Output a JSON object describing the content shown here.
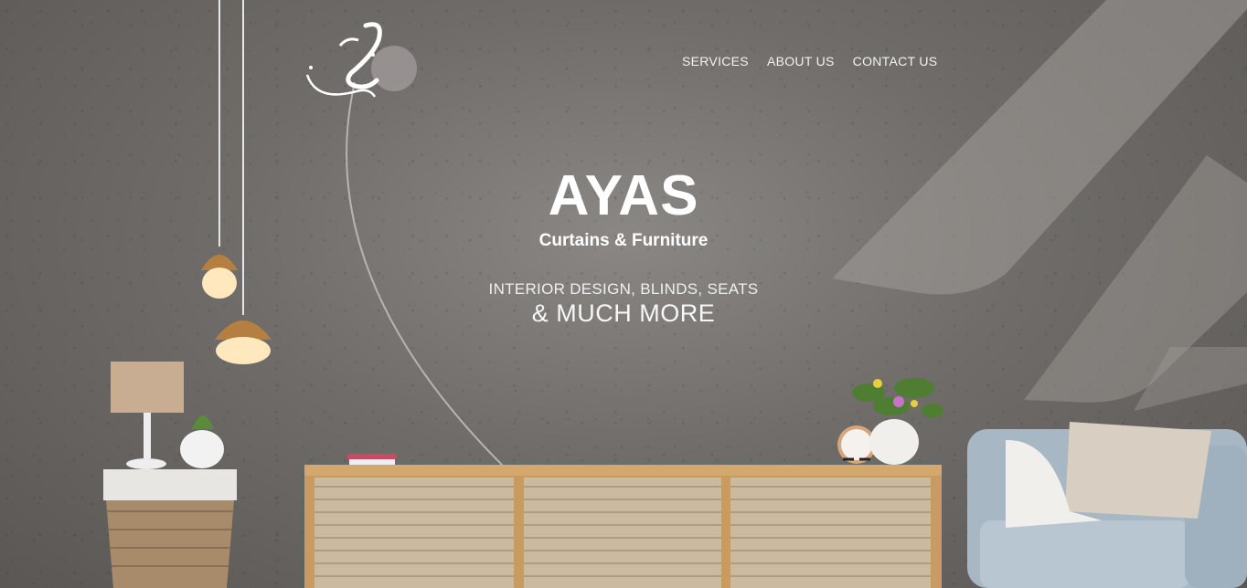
{
  "nav": {
    "items": [
      {
        "label": "SERVICES"
      },
      {
        "label": "ABOUT US"
      },
      {
        "label": "CONTACT US"
      }
    ]
  },
  "hero": {
    "brand": "AYAS",
    "subtitle": "Curtains & Furniture",
    "tagline_line1": "INTERIOR DESIGN, BLINDS, SEATS",
    "tagline_line2": "& MUCH MORE"
  },
  "colors": {
    "wall": "#7a7775",
    "text": "#ffffff",
    "wood": "#c9a06a",
    "chair": "#a9b7c2"
  },
  "icons": {
    "logo": "ayas-logo-icon"
  }
}
